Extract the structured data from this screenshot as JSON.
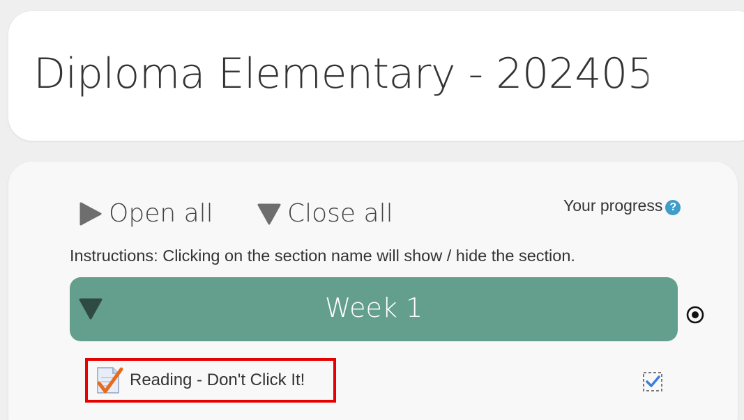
{
  "course": {
    "title": "Diploma Elementary - 202405"
  },
  "controls": {
    "open_all_label": "Open all",
    "close_all_label": "Close all",
    "progress_label": "Your progress",
    "help_icon_glyph": "?"
  },
  "instructions": "Instructions: Clicking on the section name will show / hide the section.",
  "section": {
    "title": "Week 1",
    "state": "expanded",
    "color": "#639f8c"
  },
  "activities": [
    {
      "label": "Reading - Don't Click It!",
      "icon": "assignment-icon",
      "completion": "manual-complete",
      "highlight_color": "#e60000"
    }
  ],
  "colors": {
    "help_icon": "#3e9dc9",
    "page_bg": "#efefef",
    "card_bg": "#ffffff"
  }
}
